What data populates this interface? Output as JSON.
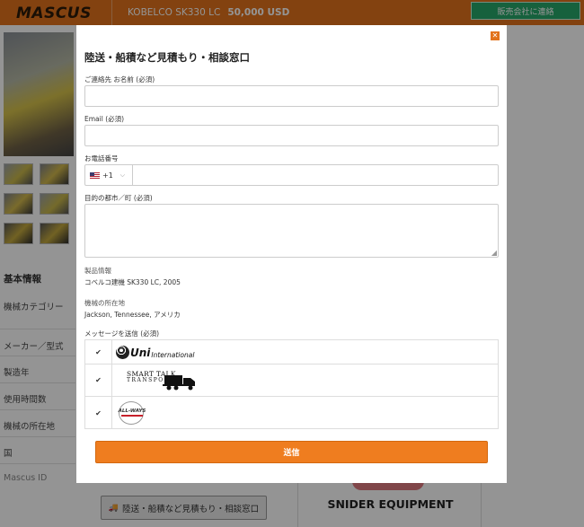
{
  "header": {
    "logo": "MASCUS",
    "title": "KOBELCO SK330 LC",
    "price": "50,000 USD",
    "contact_button": "販売会社に連絡"
  },
  "specs": {
    "heading": "基本情報",
    "rows": [
      "機械カテゴリー",
      "メーカー／型式",
      "製造年",
      "使用時間数",
      "機械の所在地",
      "国",
      "Mascus ID"
    ]
  },
  "bottom": {
    "transport_button": "陸送・船積など見積もり・相談窓口",
    "dealer_name": "SNIDER EQUIPMENT"
  },
  "modal": {
    "title": "陸送・船積など見積もり・相談窓口",
    "close_icon": "✕",
    "fields": {
      "name_label": "ご連絡先 お名前 (必須)",
      "email_label": "Email (必須)",
      "phone_label": "お電話番号",
      "phone_code": "+1",
      "destination_label": "目的の都市／町 (必須)"
    },
    "product_info_label": "製品情報",
    "product_info_value": "コベルコ建機 SK330 LC,  2005",
    "location_label": "機械の所在地",
    "location_value": "Jackson, Tennessee, アメリカ",
    "message_label": "メッセージを送信 (必須)",
    "transporters": [
      {
        "logo": "Uni",
        "logo_sub": "International",
        "checked": "✔"
      },
      {
        "logo_top": "SMART TALK",
        "logo_bottom": "TRANSPORT",
        "checked": "✔"
      },
      {
        "logo": "ALL-WAYS",
        "checked": "✔"
      }
    ],
    "submit_button": "送信"
  }
}
